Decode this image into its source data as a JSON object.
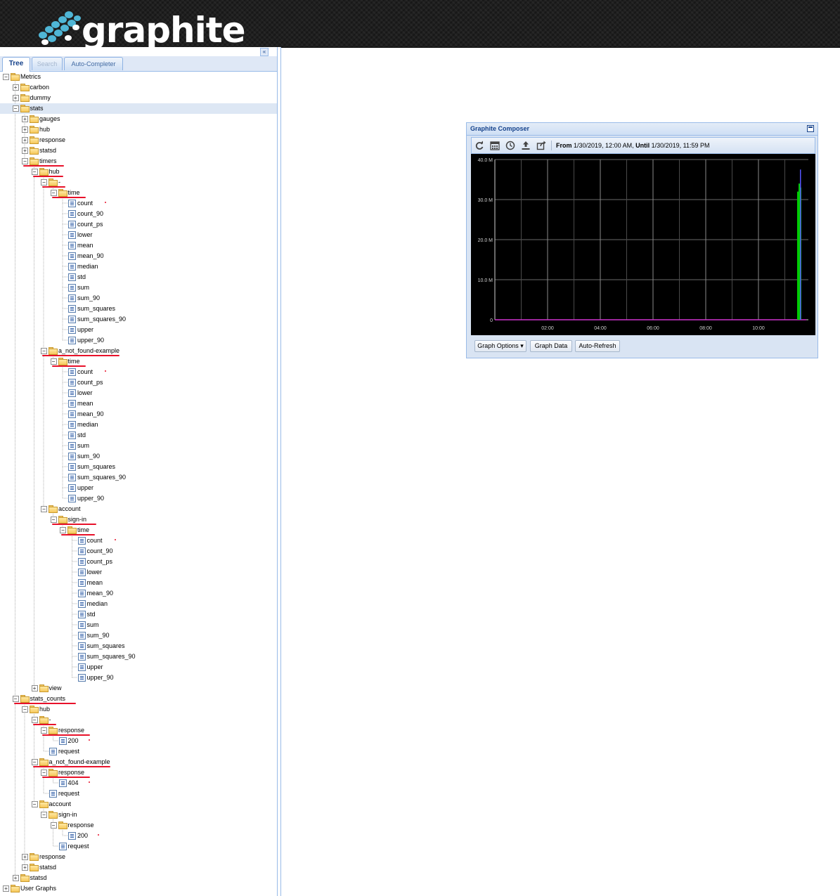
{
  "header": {
    "logo_text": "graphite"
  },
  "left_panel": {
    "tools": {
      "collapse_icon": "«",
      "refresh_icon": "⟳"
    },
    "tabs": [
      {
        "label": "Tree",
        "state": "active"
      },
      {
        "label": "Search",
        "state": "disabled"
      },
      {
        "label": "Auto-Completer",
        "state": "normal"
      }
    ]
  },
  "tree": [
    {
      "label": "Metrics",
      "d": 0,
      "t": "f",
      "e": 1
    },
    {
      "label": "carbon",
      "d": 1,
      "t": "f",
      "e": 0
    },
    {
      "label": "dummy",
      "d": 1,
      "t": "f",
      "e": 0
    },
    {
      "label": "stats",
      "d": 1,
      "t": "f",
      "e": 1,
      "sel": 1
    },
    {
      "label": "gauges",
      "d": 2,
      "t": "f",
      "e": 0
    },
    {
      "label": "hub",
      "d": 2,
      "t": "f",
      "e": 0
    },
    {
      "label": "response",
      "d": 2,
      "t": "f",
      "e": 0
    },
    {
      "label": "statsd",
      "d": 2,
      "t": "f",
      "e": 0
    },
    {
      "label": "timers",
      "d": 2,
      "t": "f",
      "e": 1
    },
    {
      "label": "hub",
      "d": 3,
      "t": "f",
      "e": 1
    },
    {
      "label": "-",
      "d": 4,
      "t": "f",
      "e": 1
    },
    {
      "label": "time",
      "d": 5,
      "t": "f",
      "e": 1
    },
    {
      "label": "count",
      "d": 6,
      "t": "l"
    },
    {
      "label": "count_90",
      "d": 6,
      "t": "l"
    },
    {
      "label": "count_ps",
      "d": 6,
      "t": "l"
    },
    {
      "label": "lower",
      "d": 6,
      "t": "l"
    },
    {
      "label": "mean",
      "d": 6,
      "t": "l"
    },
    {
      "label": "mean_90",
      "d": 6,
      "t": "l"
    },
    {
      "label": "median",
      "d": 6,
      "t": "l"
    },
    {
      "label": "std",
      "d": 6,
      "t": "l"
    },
    {
      "label": "sum",
      "d": 6,
      "t": "l"
    },
    {
      "label": "sum_90",
      "d": 6,
      "t": "l"
    },
    {
      "label": "sum_squares",
      "d": 6,
      "t": "l"
    },
    {
      "label": "sum_squares_90",
      "d": 6,
      "t": "l"
    },
    {
      "label": "upper",
      "d": 6,
      "t": "l"
    },
    {
      "label": "upper_90",
      "d": 6,
      "t": "l"
    },
    {
      "label": "a_not_found-example",
      "d": 4,
      "t": "f",
      "e": 1
    },
    {
      "label": "time",
      "d": 5,
      "t": "f",
      "e": 1
    },
    {
      "label": "count",
      "d": 6,
      "t": "l"
    },
    {
      "label": "count_ps",
      "d": 6,
      "t": "l"
    },
    {
      "label": "lower",
      "d": 6,
      "t": "l"
    },
    {
      "label": "mean",
      "d": 6,
      "t": "l"
    },
    {
      "label": "mean_90",
      "d": 6,
      "t": "l"
    },
    {
      "label": "median",
      "d": 6,
      "t": "l"
    },
    {
      "label": "std",
      "d": 6,
      "t": "l"
    },
    {
      "label": "sum",
      "d": 6,
      "t": "l"
    },
    {
      "label": "sum_90",
      "d": 6,
      "t": "l"
    },
    {
      "label": "sum_squares",
      "d": 6,
      "t": "l"
    },
    {
      "label": "sum_squares_90",
      "d": 6,
      "t": "l"
    },
    {
      "label": "upper",
      "d": 6,
      "t": "l"
    },
    {
      "label": "upper_90",
      "d": 6,
      "t": "l"
    },
    {
      "label": "account",
      "d": 4,
      "t": "f",
      "e": 1
    },
    {
      "label": "sign-in",
      "d": 5,
      "t": "f",
      "e": 1
    },
    {
      "label": "time",
      "d": 6,
      "t": "f",
      "e": 1
    },
    {
      "label": "count",
      "d": 7,
      "t": "l"
    },
    {
      "label": "count_90",
      "d": 7,
      "t": "l"
    },
    {
      "label": "count_ps",
      "d": 7,
      "t": "l"
    },
    {
      "label": "lower",
      "d": 7,
      "t": "l"
    },
    {
      "label": "mean",
      "d": 7,
      "t": "l"
    },
    {
      "label": "mean_90",
      "d": 7,
      "t": "l"
    },
    {
      "label": "median",
      "d": 7,
      "t": "l"
    },
    {
      "label": "std",
      "d": 7,
      "t": "l"
    },
    {
      "label": "sum",
      "d": 7,
      "t": "l"
    },
    {
      "label": "sum_90",
      "d": 7,
      "t": "l"
    },
    {
      "label": "sum_squares",
      "d": 7,
      "t": "l"
    },
    {
      "label": "sum_squares_90",
      "d": 7,
      "t": "l"
    },
    {
      "label": "upper",
      "d": 7,
      "t": "l"
    },
    {
      "label": "upper_90",
      "d": 7,
      "t": "l"
    },
    {
      "label": "view",
      "d": 3,
      "t": "f",
      "e": 0
    },
    {
      "label": "stats_counts",
      "d": 1,
      "t": "f",
      "e": 1
    },
    {
      "label": "hub",
      "d": 2,
      "t": "f",
      "e": 1
    },
    {
      "label": "-",
      "d": 3,
      "t": "f",
      "e": 1
    },
    {
      "label": "response",
      "d": 4,
      "t": "f",
      "e": 1
    },
    {
      "label": "200",
      "d": 5,
      "t": "l"
    },
    {
      "label": "request",
      "d": 4,
      "t": "l"
    },
    {
      "label": "a_not_found-example",
      "d": 3,
      "t": "f",
      "e": 1
    },
    {
      "label": "response",
      "d": 4,
      "t": "f",
      "e": 1
    },
    {
      "label": "404",
      "d": 5,
      "t": "l"
    },
    {
      "label": "request",
      "d": 4,
      "t": "l"
    },
    {
      "label": "account",
      "d": 3,
      "t": "f",
      "e": 1
    },
    {
      "label": "sign-in",
      "d": 4,
      "t": "f",
      "e": 1
    },
    {
      "label": "response",
      "d": 5,
      "t": "f",
      "e": 1
    },
    {
      "label": "200",
      "d": 6,
      "t": "l"
    },
    {
      "label": "request",
      "d": 5,
      "t": "l"
    },
    {
      "label": "response",
      "d": 2,
      "t": "f",
      "e": 0
    },
    {
      "label": "statsd",
      "d": 2,
      "t": "f",
      "e": 0
    },
    {
      "label": "statsd",
      "d": 1,
      "t": "f",
      "e": 0
    },
    {
      "label": "User Graphs",
      "d": 0,
      "t": "f",
      "e": 0
    }
  ],
  "composer": {
    "title": "Graphite Composer",
    "toolbar_icons": [
      "refresh-icon",
      "calendar-icon",
      "clock-icon",
      "upload-icon",
      "share-icon"
    ],
    "time_range": {
      "from_label": "From",
      "from_value": "1/30/2019, 12:00 AM",
      "until_label": "Until",
      "until_value": "1/30/2019, 11:59 PM"
    },
    "buttons": {
      "graph_options": "Graph Options",
      "graph_data": "Graph Data",
      "auto_refresh": "Auto-Refresh"
    }
  },
  "chart_data": {
    "type": "bar",
    "y_ticks": [
      "0",
      "10.0 M",
      "20.0 M",
      "30.0 M",
      "40.0 M"
    ],
    "x_ticks": [
      "02:00",
      "04:00",
      "06:00",
      "08:00",
      "10:00"
    ],
    "ylim": [
      0,
      40000000
    ],
    "grid": true,
    "background": "#000000",
    "series": [
      {
        "color": "#00cc00",
        "values": [
          32000000,
          34000000,
          33000000
        ]
      },
      {
        "color": "#5555ff",
        "values": [
          37500000
        ]
      },
      {
        "color": "#cc33cc",
        "values": [
          0
        ]
      }
    ]
  }
}
